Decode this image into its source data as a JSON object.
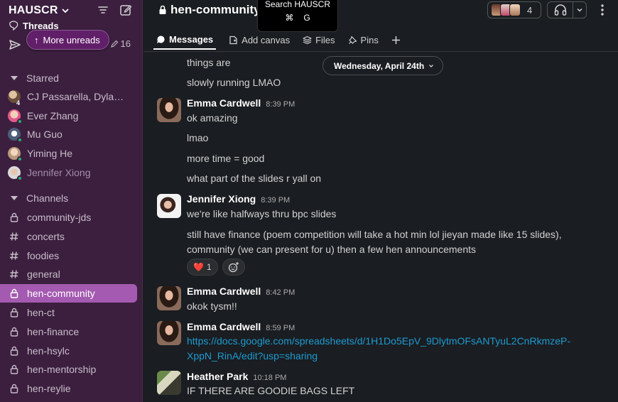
{
  "workspace": {
    "name": "HAUSCR"
  },
  "sidebar": {
    "threads_label": "Threads",
    "more_unreads_label": "More unreads",
    "draft_count": "16",
    "starred": {
      "heading": "Starred",
      "items": [
        {
          "label": "CJ Passarella, Dylan ...",
          "badge": "4"
        },
        {
          "label": "Ever Zhang"
        },
        {
          "label": "Mu Guo"
        },
        {
          "label": "Yiming He"
        },
        {
          "label": "Jennifer Xiong"
        }
      ]
    },
    "channels": {
      "heading": "Channels",
      "items": [
        {
          "label": "community-jds",
          "icon": "lock-icon"
        },
        {
          "label": "concerts",
          "icon": "hash-icon"
        },
        {
          "label": "foodies",
          "icon": "hash-icon"
        },
        {
          "label": "general",
          "icon": "hash-icon"
        },
        {
          "label": "hen-community",
          "icon": "lock-icon",
          "active": true
        },
        {
          "label": "hen-ct",
          "icon": "lock-icon"
        },
        {
          "label": "hen-finance",
          "icon": "lock-icon"
        },
        {
          "label": "hen-hsylc",
          "icon": "lock-icon"
        },
        {
          "label": "hen-mentorship",
          "icon": "lock-icon"
        },
        {
          "label": "hen-reylie",
          "icon": "lock-icon"
        }
      ]
    }
  },
  "header": {
    "channel_name": "hen-community",
    "member_count": "4",
    "search_tooltip": {
      "title": "Search HAUSCR",
      "key1": "⌘",
      "key2": "G"
    }
  },
  "tabs": [
    {
      "label": "Messages",
      "icon": "message-icon"
    },
    {
      "label": "Add canvas",
      "icon": "canvas-icon"
    },
    {
      "label": "Files",
      "icon": "files-icon"
    },
    {
      "label": "Pins",
      "icon": "pin-icon"
    }
  ],
  "date_divider": "Wednesday, April 24th",
  "messages": {
    "m0": {
      "lines": [
        "things are",
        "slowly running LMAO"
      ]
    },
    "m1": {
      "author": "Emma Cardwell",
      "time": "8:39 PM",
      "lines": [
        "ok amazing",
        "lmao",
        "more time = good",
        "what part of the slides r yall on"
      ]
    },
    "m2": {
      "author": "Jennifer Xiong",
      "time": "8:39 PM",
      "lines": [
        "we're like halfways thru bpc slides",
        "still have finance (poem competition will take a hot min lol jieyan made like 15 slides),",
        "community (we can present for u) then a few hen announcements"
      ],
      "reaction_emoji": "❤️",
      "reaction_count": "1"
    },
    "m3": {
      "author": "Emma Cardwell",
      "time": "8:42 PM",
      "lines": [
        "okok tysm!!"
      ]
    },
    "m4": {
      "author": "Emma Cardwell",
      "time": "8:59 PM",
      "link_line1": "https://docs.google.com/spreadsheets/d/1H1Do5EpV_9DlytmOFsANTyuL2CnRkmzeP-",
      "link_line2": "XppN_RinA/edit?usp=sharing"
    },
    "m5": {
      "author": "Heather Park",
      "time": "10:18 PM",
      "lines": [
        "IF THERE ARE GOODIE BAGS LEFT"
      ]
    }
  },
  "colors": {
    "sidebar_bg": "#3c1f3f",
    "active_item": "#a45ab0",
    "link": "#1d9bd1",
    "main_bg": "#1a1d21"
  }
}
